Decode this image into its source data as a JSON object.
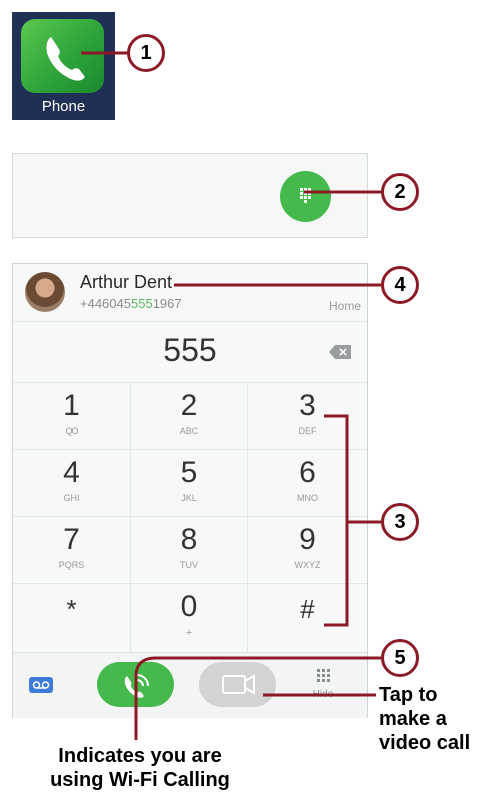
{
  "app_icon": {
    "label": "Phone"
  },
  "contact": {
    "name": "Arthur Dent",
    "number_prefix": "+446045",
    "number_match": "555",
    "number_suffix": "1967",
    "type": "Home"
  },
  "dialed_number": "555",
  "keypad": [
    {
      "digit": "1",
      "letters": "QO"
    },
    {
      "digit": "2",
      "letters": "ABC"
    },
    {
      "digit": "3",
      "letters": "DEF"
    },
    {
      "digit": "4",
      "letters": "GHI"
    },
    {
      "digit": "5",
      "letters": "JKL"
    },
    {
      "digit": "6",
      "letters": "MNO"
    },
    {
      "digit": "7",
      "letters": "PQRS"
    },
    {
      "digit": "8",
      "letters": "TUV"
    },
    {
      "digit": "9",
      "letters": "WXYZ"
    },
    {
      "digit": "*",
      "letters": ""
    },
    {
      "digit": "0",
      "letters": "+"
    },
    {
      "digit": "#",
      "letters": ""
    }
  ],
  "bottom_bar": {
    "hide_label": "Hide"
  },
  "callouts": [
    "1",
    "2",
    "3",
    "4",
    "5"
  ],
  "captions": {
    "video_call": [
      "Tap to",
      "make a",
      "video call"
    ],
    "wifi_calling": [
      "Indicates you are",
      "using Wi-Fi Calling"
    ]
  },
  "colors": {
    "accent_green": "#45b94b",
    "callout_red": "#8c1a26",
    "match_highlight": "#5cb85c"
  },
  "icons": [
    "phone-handset-icon",
    "dialpad-icon",
    "backspace-icon",
    "voicemail-icon",
    "wifi-call-icon",
    "video-camera-icon",
    "dialpad-hide-icon"
  ]
}
